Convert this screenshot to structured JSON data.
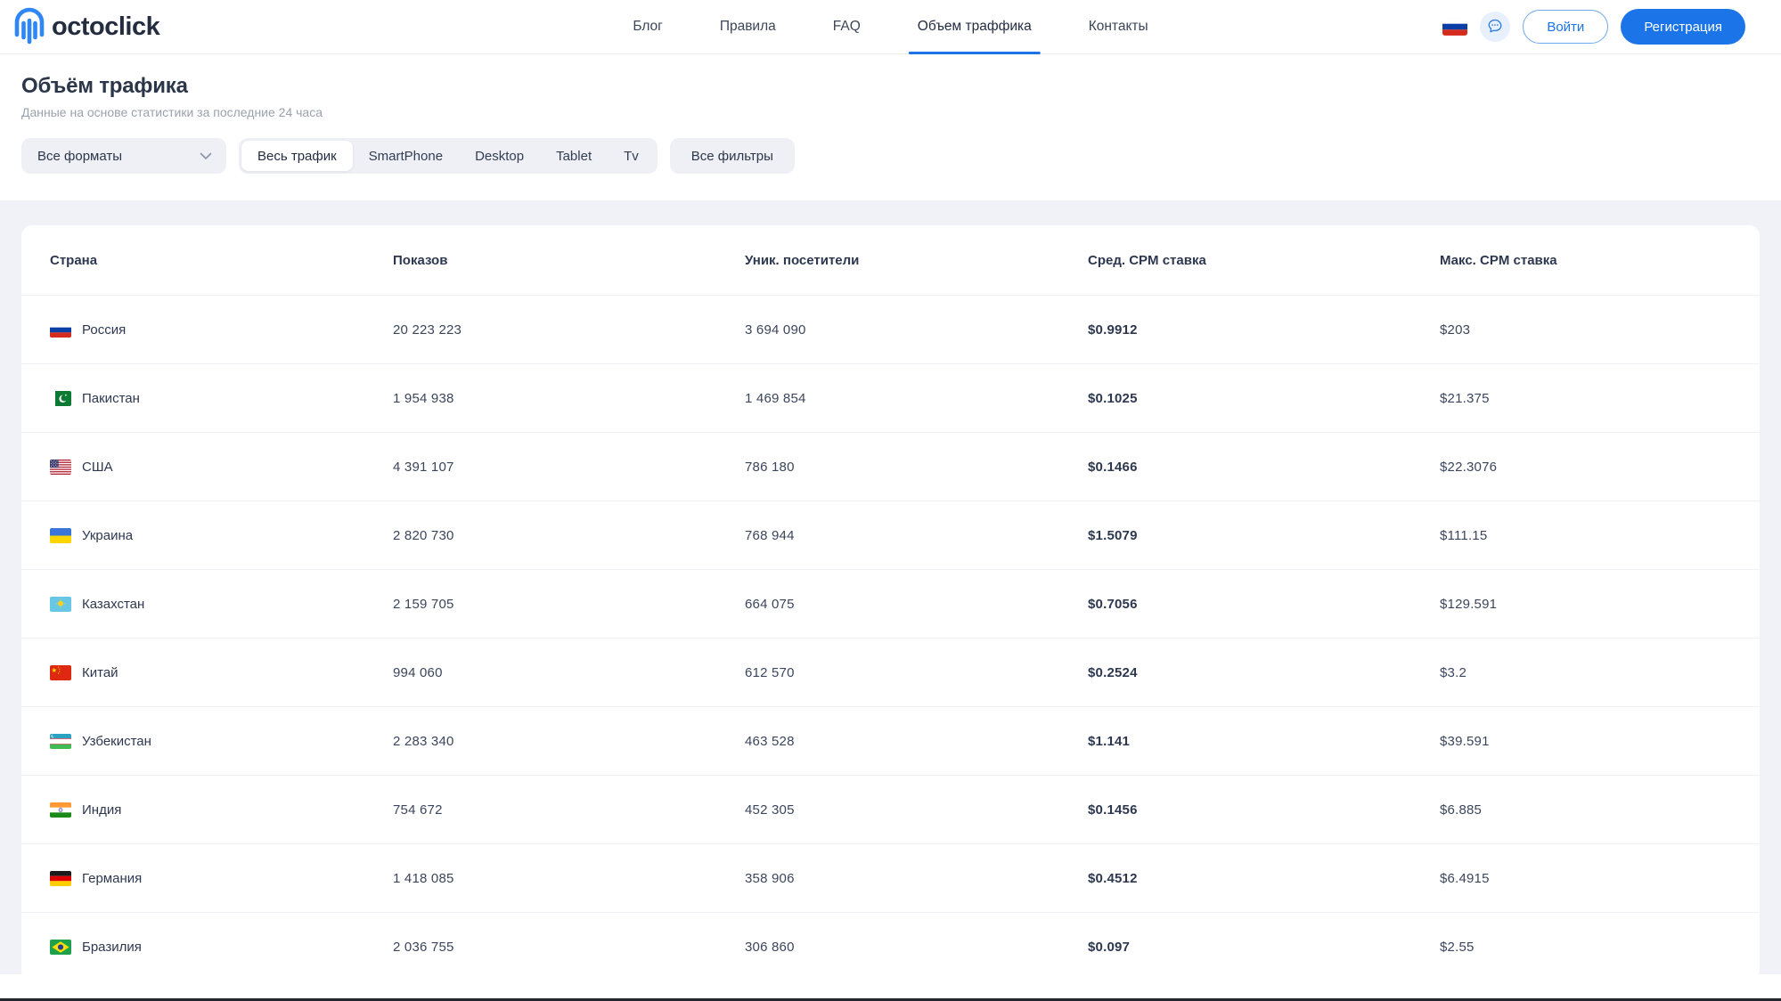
{
  "colors": {
    "accent": "#1b74e8",
    "nav_underline": "#2a7de1",
    "page_bg": "#f1f2f7",
    "text_primary": "#2d3850",
    "text_secondary": "#9aa2ad"
  },
  "brand": {
    "name": "octoclick"
  },
  "nav": [
    {
      "label": "Блог",
      "active": false
    },
    {
      "label": "Правила",
      "active": false
    },
    {
      "label": "FAQ",
      "active": false
    },
    {
      "label": "Объем траффика",
      "active": true
    },
    {
      "label": "Контакты",
      "active": false
    }
  ],
  "header_actions": {
    "language_flag": "ru",
    "chat_icon": "chat-bubble-icon",
    "login": "Войти",
    "register": "Регистрация"
  },
  "page": {
    "title": "Объём трафика",
    "subtitle": "Данные на основе статистики за последние 24 часа"
  },
  "filters": {
    "format_select": {
      "value": "Все форматы"
    },
    "segments": [
      {
        "label": "Весь трафик",
        "active": true
      },
      {
        "label": "SmartPhone",
        "active": false
      },
      {
        "label": "Desktop",
        "active": false
      },
      {
        "label": "Tablet",
        "active": false
      },
      {
        "label": "Tv",
        "active": false
      }
    ],
    "all_filters_label": "Все фильтры"
  },
  "table": {
    "columns": [
      "Страна",
      "Показов",
      "Уник. посетители",
      "Сред. CPM ставка",
      "Макс. CPM ставка"
    ],
    "rows": [
      {
        "flag": "ru",
        "country": "Россия",
        "impressions": "20 223 223",
        "unique": "3 694 090",
        "avg_cpm": "$0.9912",
        "max_cpm": "$203"
      },
      {
        "flag": "pk",
        "country": "Пакистан",
        "impressions": "1 954 938",
        "unique": "1 469 854",
        "avg_cpm": "$0.1025",
        "max_cpm": "$21.375"
      },
      {
        "flag": "us",
        "country": "США",
        "impressions": "4 391 107",
        "unique": "786 180",
        "avg_cpm": "$0.1466",
        "max_cpm": "$22.3076"
      },
      {
        "flag": "ua",
        "country": "Украина",
        "impressions": "2 820 730",
        "unique": "768 944",
        "avg_cpm": "$1.5079",
        "max_cpm": "$111.15"
      },
      {
        "flag": "kz",
        "country": "Казахстан",
        "impressions": "2 159 705",
        "unique": "664 075",
        "avg_cpm": "$0.7056",
        "max_cpm": "$129.591"
      },
      {
        "flag": "cn",
        "country": "Китай",
        "impressions": "994 060",
        "unique": "612 570",
        "avg_cpm": "$0.2524",
        "max_cpm": "$3.2"
      },
      {
        "flag": "uz",
        "country": "Узбекистан",
        "impressions": "2 283 340",
        "unique": "463 528",
        "avg_cpm": "$1.141",
        "max_cpm": "$39.591"
      },
      {
        "flag": "in",
        "country": "Индия",
        "impressions": "754 672",
        "unique": "452 305",
        "avg_cpm": "$0.1456",
        "max_cpm": "$6.885"
      },
      {
        "flag": "de",
        "country": "Германия",
        "impressions": "1 418 085",
        "unique": "358 906",
        "avg_cpm": "$0.4512",
        "max_cpm": "$6.4915"
      },
      {
        "flag": "br",
        "country": "Бразилия",
        "impressions": "2 036 755",
        "unique": "306 860",
        "avg_cpm": "$0.097",
        "max_cpm": "$2.55"
      }
    ]
  }
}
